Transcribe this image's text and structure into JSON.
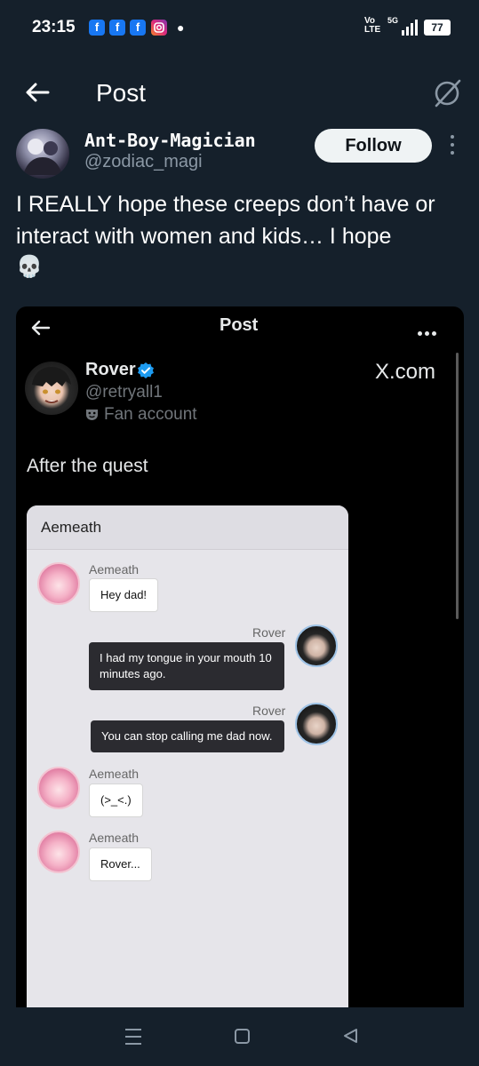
{
  "status_bar": {
    "time": "23:15",
    "notifications": [
      "f",
      "f",
      "f"
    ],
    "network": "Vo\nLTE",
    "network_gen": "5G",
    "battery": "77"
  },
  "header": {
    "title": "Post",
    "back_icon": "arrow-left-icon",
    "right_icon": "grok-icon"
  },
  "author": {
    "display_name": "Ant-Boy-Magician",
    "handle": "@zodiac_magi",
    "follow_label": "Follow"
  },
  "tweet": {
    "text": "I REALLY hope these creeps don’t have or interact with women and kids… I hope",
    "emoji": "💀"
  },
  "embed": {
    "title": "Post",
    "author_name": "Rover",
    "author_handle": "@retryall1",
    "fan_label": "Fan account",
    "site": "X.com",
    "text": "After the quest",
    "chat": {
      "title": "Aemeath",
      "messages": [
        {
          "from": "Aemeath",
          "text": "Hey dad!",
          "side": "in"
        },
        {
          "from": "Rover",
          "text": "I had my tongue in your mouth 10 minutes ago.",
          "side": "out"
        },
        {
          "from": "Rover",
          "text": "You can stop calling me dad now.",
          "side": "out"
        },
        {
          "from": "Aemeath",
          "text": "(>_<.)",
          "side": "in"
        },
        {
          "from": "Aemeath",
          "text": "Rover...",
          "side": "in"
        }
      ]
    }
  },
  "colors": {
    "background": "#15202b",
    "follow_bg": "#eff3f4",
    "verified": "#1d9bf0",
    "muted_text": "#8b98a5"
  }
}
